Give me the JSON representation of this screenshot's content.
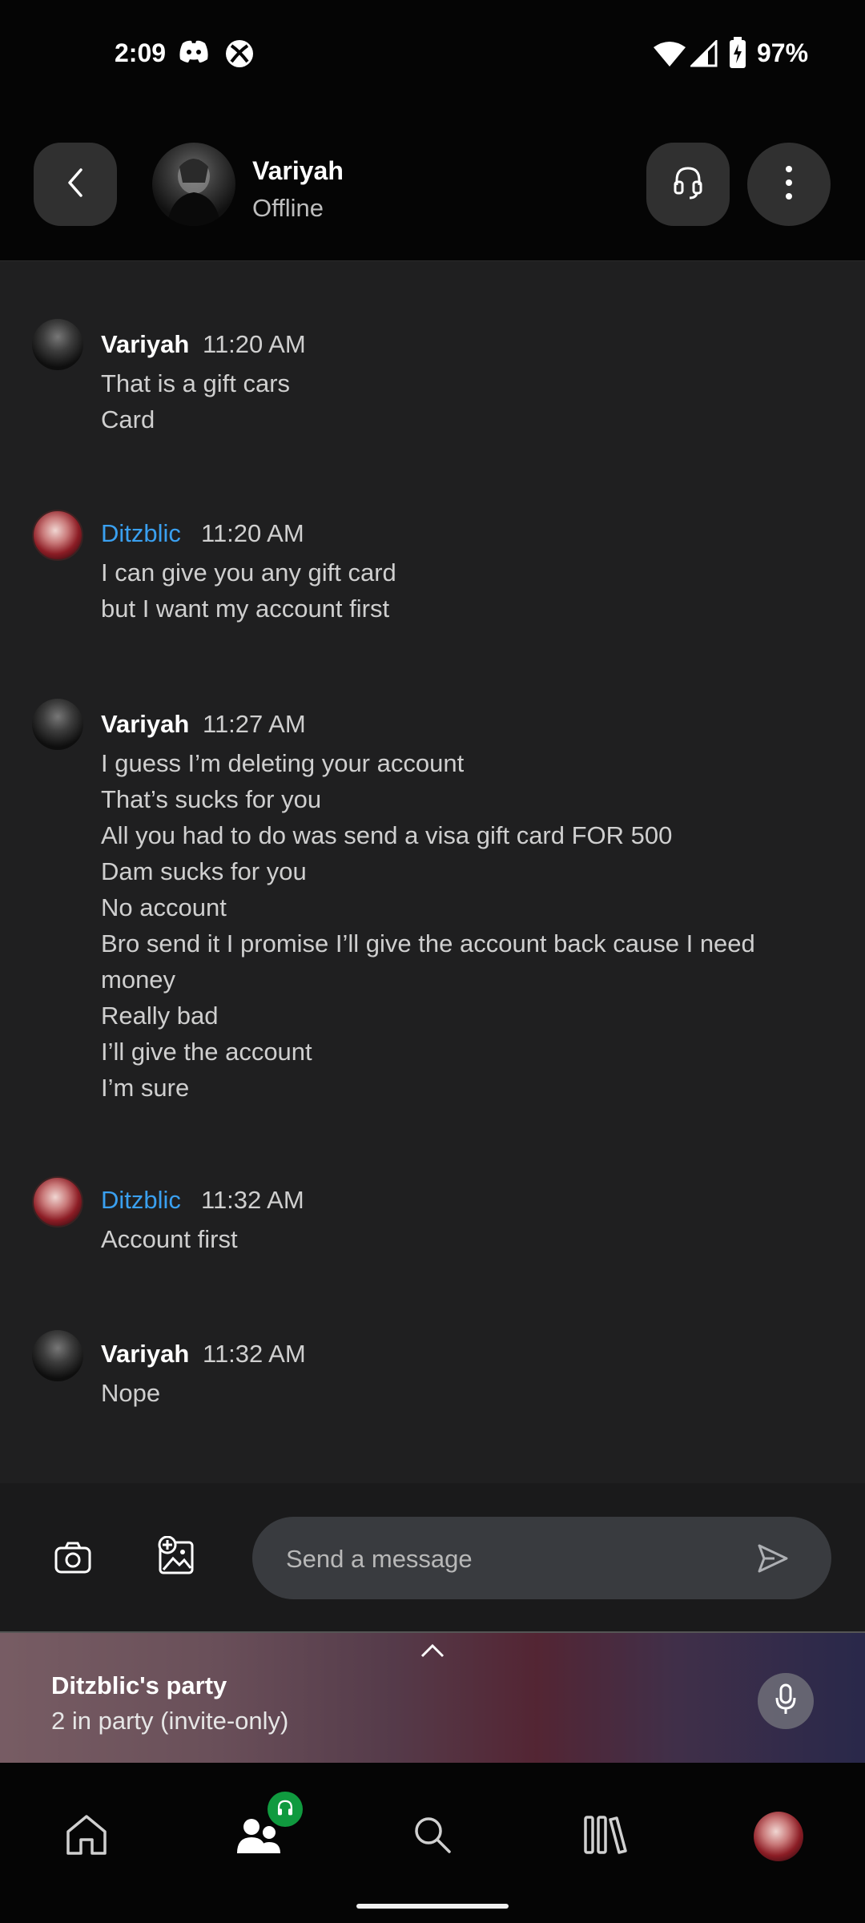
{
  "status_bar": {
    "time": "2:09",
    "battery": "97%",
    "icons": [
      "discord-icon",
      "xbox-icon",
      "wifi-icon",
      "signal-icon",
      "battery-charging-icon"
    ]
  },
  "header": {
    "contact_name": "Variyah",
    "contact_status": "Offline",
    "icons": [
      "back-icon",
      "headset-icon",
      "more-vert-icon"
    ]
  },
  "messages": [
    {
      "sender": "Variyah",
      "time": "11:20 AM",
      "lines": [
        "That is a gift cars",
        "Card"
      ]
    },
    {
      "sender": "Ditzblic",
      "time": "11:20 AM",
      "lines": [
        "I can give you any gift card",
        "but I want my account first"
      ]
    },
    {
      "sender": "Variyah",
      "time": "11:27 AM",
      "lines": [
        "I guess I’m deleting your account",
        "That’s sucks for you",
        "All you had to do was send a visa gift card FOR 500",
        "Dam sucks for you",
        "No account",
        "Bro send it I promise I’ll give the account back cause I need money",
        "Really bad",
        "I’ll give the account",
        "I’m sure"
      ]
    },
    {
      "sender": "Ditzblic",
      "time": "11:32 AM",
      "lines": [
        "Account first"
      ]
    },
    {
      "sender": "Variyah",
      "time": "11:32 AM",
      "lines": [
        "Nope"
      ]
    }
  ],
  "composer": {
    "placeholder": "Send a message",
    "icons": [
      "camera-icon",
      "add-image-icon",
      "send-icon"
    ]
  },
  "party": {
    "title": "Ditzblic's party",
    "subtitle": "2 in party (invite-only)",
    "icons": [
      "chevron-up-icon",
      "microphone-icon"
    ]
  },
  "nav": {
    "items": [
      "home-icon",
      "social-icon",
      "search-icon",
      "library-icon",
      "profile-avatar"
    ],
    "active": "social-icon"
  },
  "colors": {
    "accent_blue": "#3aa0f0",
    "badge_green": "#109a3f",
    "background": "#1f1f20",
    "header_bg": "#050505"
  }
}
